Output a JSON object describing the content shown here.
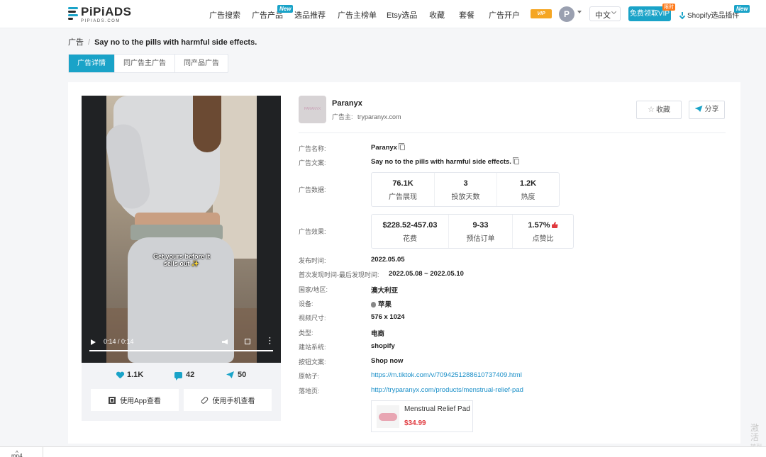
{
  "brand": {
    "name": "PiPiADS",
    "sub": "PIPIADS.COM"
  },
  "nav": {
    "items": [
      "广告搜索",
      "广告产品",
      "选品推荐",
      "广告主榜单",
      "Etsy选品",
      "收藏",
      "套餐",
      "广告开户"
    ],
    "new_badge": "New",
    "limit_badge": "限时",
    "vip_logo": "VIP",
    "avatar_letter": "P",
    "language": "中文",
    "vip_button": "免费领取VIP",
    "shopify_plugin": "Shopify选品插件"
  },
  "breadcrumb": {
    "root": "广告",
    "sep": "/",
    "current": "Say no to the pills with harmful side effects."
  },
  "tabs": [
    "广告详情",
    "同广告主广告",
    "同产品广告"
  ],
  "video": {
    "caption_line1": "Get yours before it",
    "caption_line2": "sells out ✨",
    "time": "0:14 / 0:14",
    "progress": 1.0,
    "likes": "1.1K",
    "comments": "42",
    "shares": "50",
    "btn_app": "使用App查看",
    "btn_phone": "使用手机查看"
  },
  "advertiser": {
    "name": "Paranyx",
    "sub_label": "广告主:",
    "domain": "tryparanyx.com",
    "collect": "收藏",
    "share": "分享"
  },
  "details": {
    "ad_name_label": "广告名称:",
    "ad_name": "Paranyx",
    "ad_copy_label": "广告文案:",
    "ad_copy": "Say no to the pills with harmful side effects.",
    "ad_data_label": "广告数据:",
    "data_metrics": [
      {
        "n": "76.1K",
        "t": "广告展现"
      },
      {
        "n": "3",
        "t": "投放天数"
      },
      {
        "n": "1.2K",
        "t": "热度"
      }
    ],
    "effect_label": "广告效果:",
    "effect_metrics": [
      {
        "n": "$228.52-457.03",
        "t": "花费"
      },
      {
        "n": "9-33",
        "t": "预估订单"
      },
      {
        "n": "1.57%",
        "t": "点赞比"
      }
    ],
    "publish_label": "发布时间:",
    "publish": "2022.05.05",
    "first_last_label": "首次发现时间-最后发现时间:",
    "first_last": "2022.05.08 ~ 2022.05.10",
    "country_label": "国家/地区:",
    "country": "澳大利亚",
    "device_label": "设备:",
    "device": "苹果",
    "size_label": "视频尺寸:",
    "size": "576 x 1024",
    "type_label": "类型:",
    "type": "电商",
    "site_label": "建站系统:",
    "site": "shopify",
    "cta_label": "按钮文案:",
    "cta": "Shop now",
    "post_label": "原帖子:",
    "post_url": "https://m.tiktok.com/v/7094251288610737409.html",
    "landing_label": "落地页:",
    "landing_url": "http://tryparanyx.com/products/menstrual-relief-pad"
  },
  "product": {
    "name": "Menstrual Relief Pad",
    "price": "$34.99"
  },
  "watermark": {
    "line1": "激活",
    "line2": "转到"
  },
  "download_bar": {
    "file": "mp4",
    "chevron": "^"
  }
}
